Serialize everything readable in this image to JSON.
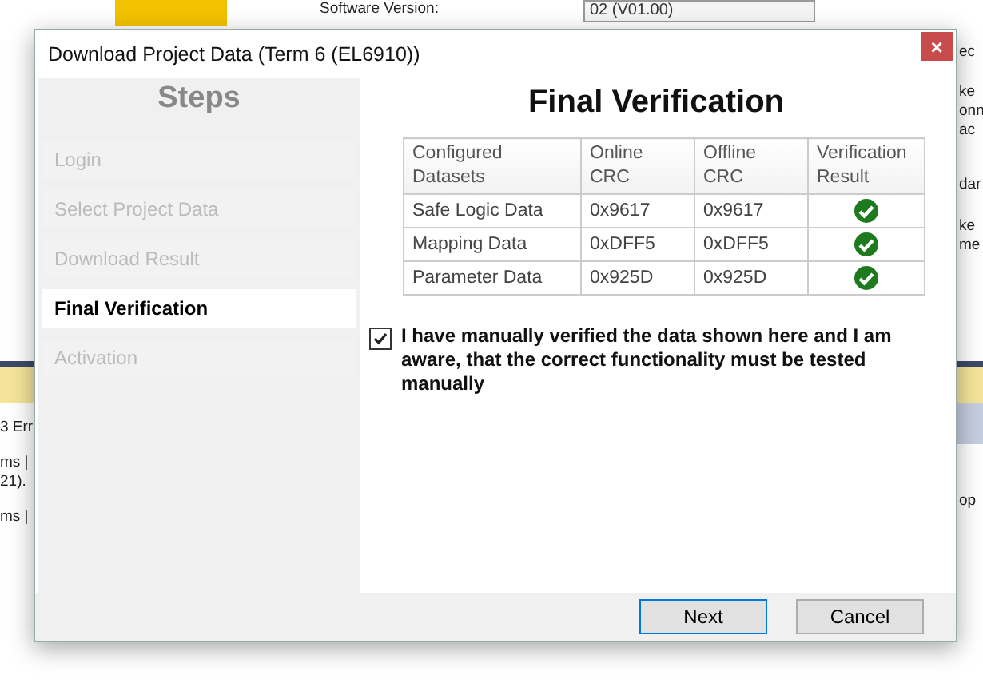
{
  "background": {
    "top_label": "Software Version:",
    "top_value": "02 (V01.00)",
    "left_fragments": [
      "3 Err",
      "ms |",
      "21).",
      "ms |"
    ],
    "right_fragments": [
      "ec",
      "ke",
      "onn",
      "ac",
      "dar",
      "ke",
      "me",
      "op"
    ]
  },
  "window": {
    "title": "Download Project Data (Term 6 (EL6910))",
    "close": "×"
  },
  "sidebar": {
    "title": "Steps",
    "items": [
      {
        "label": "Login",
        "selected": false
      },
      {
        "label": "Select Project Data",
        "selected": false
      },
      {
        "label": "Download Result",
        "selected": false
      },
      {
        "label": "Final Verification",
        "selected": true
      },
      {
        "label": "Activation",
        "selected": false
      }
    ]
  },
  "main": {
    "title": "Final Verification",
    "table": {
      "columns": [
        "Configured Datasets",
        "Online CRC",
        "Offline CRC",
        "Verification Result"
      ],
      "rows": [
        {
          "dataset": "Safe Logic Data",
          "online": "0x9617",
          "offline": "0x9617",
          "verified": true
        },
        {
          "dataset": "Mapping Data",
          "online": "0xDFF5",
          "offline": "0xDFF5",
          "verified": true
        },
        {
          "dataset": "Parameter Data",
          "online": "0x925D",
          "offline": "0x925D",
          "verified": true
        }
      ]
    },
    "confirmation": {
      "label": "I have manually verified the data shown here and I am aware, that the correct functionality must be tested manually",
      "checked": true
    }
  },
  "buttons": [
    {
      "label": "Next",
      "selected": true
    },
    {
      "label": "Cancel",
      "selected": false
    }
  ]
}
